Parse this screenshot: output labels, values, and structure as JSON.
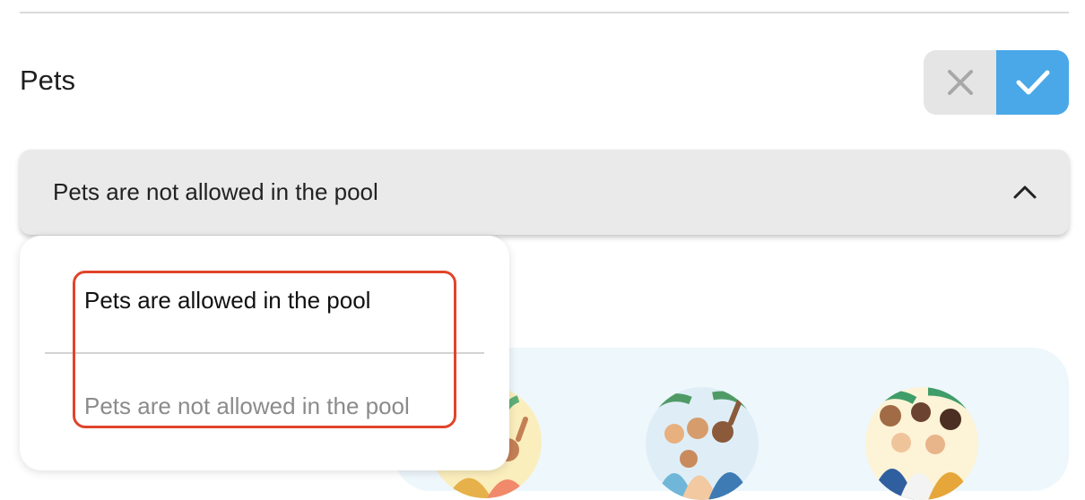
{
  "section": {
    "title": "Pets"
  },
  "toggle": {
    "no_icon": "close-icon",
    "yes_icon": "check-icon",
    "selected": "yes"
  },
  "select": {
    "value": "Pets are not allowed in the pool",
    "chevron": "chevron-up-icon",
    "expanded": true
  },
  "dropdown": {
    "options": [
      {
        "label": "Pets are allowed in the pool"
      },
      {
        "label": "Pets are not allowed in the pool"
      }
    ]
  },
  "illustrations": [
    {
      "name": "group-illustration-1"
    },
    {
      "name": "group-illustration-2"
    },
    {
      "name": "group-illustration-3"
    }
  ],
  "colors": {
    "accent": "#4aa8e8",
    "highlight": "#e0452b",
    "toggle_off": "#e5e5e5",
    "select_bg": "#eaeaea",
    "panel_bg": "#eef7fc"
  }
}
